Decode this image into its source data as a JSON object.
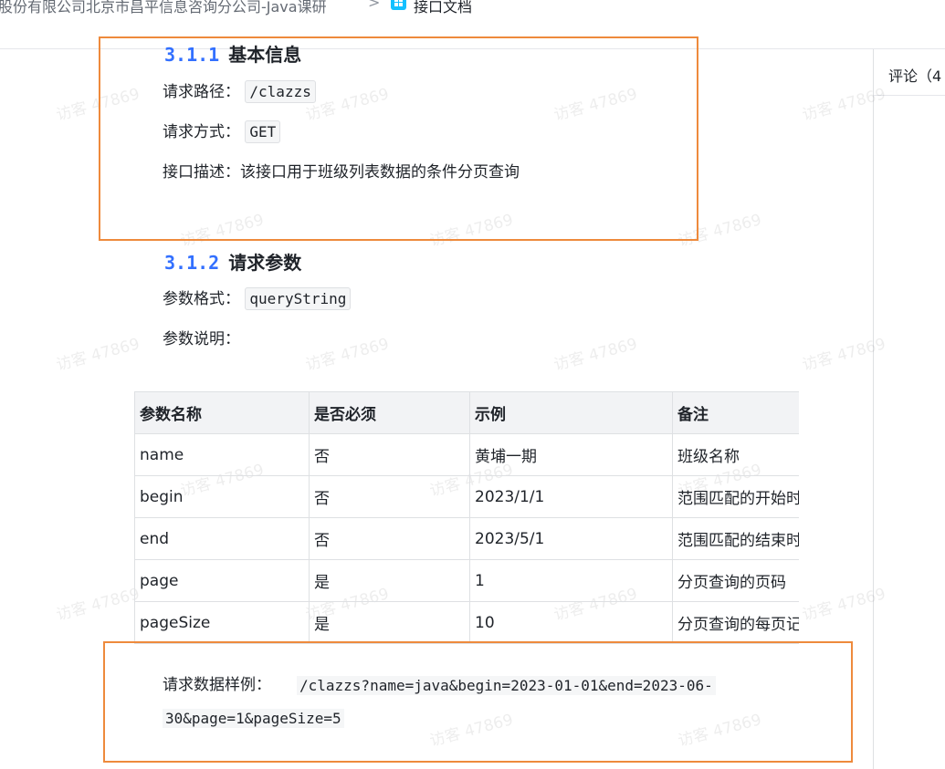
{
  "breadcrumb": {
    "parent": "股份有限公司北京市昌平信息咨询分公司-Java课研",
    "separator": ">",
    "current": "接口文档"
  },
  "side_panel": {
    "tab_label": "评论（4"
  },
  "watermark_text": "访客 47869",
  "section_311": {
    "number": "3.1.1",
    "title": "基本信息",
    "path_label": "请求路径：",
    "path_value": "/clazzs",
    "method_label": "请求方式：",
    "method_value": "GET",
    "desc_label": "接口描述：",
    "desc_value": "该接口用于班级列表数据的条件分页查询"
  },
  "section_312": {
    "number": "3.1.2",
    "title": "请求参数",
    "format_label": "参数格式：",
    "format_value": "queryString",
    "explain_label": "参数说明："
  },
  "param_table": {
    "headers": [
      "参数名称",
      "是否必须",
      "示例",
      "备注"
    ],
    "rows": [
      [
        "name",
        "否",
        "黄埔一期",
        "班级名称"
      ],
      [
        "begin",
        "否",
        "2023/1/1",
        "范围匹配的开始时间"
      ],
      [
        "end",
        "否",
        "2023/5/1",
        "范围匹配的结束时间"
      ],
      [
        "page",
        "是",
        "1",
        "分页查询的页码"
      ],
      [
        "pageSize",
        "是",
        "10",
        "分页查询的每页记录数"
      ]
    ]
  },
  "example": {
    "label": "请求数据样例：",
    "line1": "/clazzs?name=java&begin=2023-01-01&end=2023-06-",
    "line2": "30&page=1&pageSize=5"
  },
  "colors": {
    "accent_number": "#3370ff",
    "highlight_box": "#ee8a3c",
    "doc_icon": "#14c0ff"
  }
}
